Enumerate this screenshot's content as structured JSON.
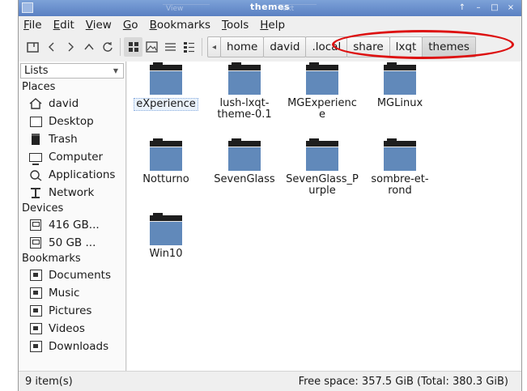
{
  "window": {
    "title": "themes",
    "ghost_tabs": [
      "View",
      "Text"
    ],
    "controls": [
      "↑",
      "–",
      "□",
      "×"
    ]
  },
  "menu": [
    "File",
    "Edit",
    "View",
    "Go",
    "Bookmarks",
    "Tools",
    "Help"
  ],
  "menu_mnemonics": [
    "F",
    "E",
    "V",
    "G",
    "B",
    "T",
    "H"
  ],
  "pathbar": {
    "scroll_left": "◂",
    "crumbs": [
      "home",
      "david",
      ".local",
      "share",
      "lxqt",
      "themes"
    ],
    "current": "themes"
  },
  "side_panel": {
    "mode": "Lists",
    "sections": {
      "places": {
        "title": "Places",
        "items": [
          {
            "label": "david",
            "icon": "home-icon"
          },
          {
            "label": "Desktop",
            "icon": "desktop-icon"
          },
          {
            "label": "Trash",
            "icon": "trash-icon"
          },
          {
            "label": "Computer",
            "icon": "computer-icon"
          },
          {
            "label": "Applications",
            "icon": "applications-icon"
          },
          {
            "label": "Network",
            "icon": "network-icon"
          }
        ]
      },
      "devices": {
        "title": "Devices",
        "items": [
          {
            "label": "416 GB...",
            "icon": "drive-icon"
          },
          {
            "label": "50 GB ...",
            "icon": "drive-icon"
          }
        ]
      },
      "bookmarks": {
        "title": "Bookmarks",
        "items": [
          {
            "label": "Documents",
            "icon": "documents-icon"
          },
          {
            "label": "Music",
            "icon": "music-icon"
          },
          {
            "label": "Pictures",
            "icon": "pictures-icon"
          },
          {
            "label": "Videos",
            "icon": "videos-icon"
          },
          {
            "label": "Downloads",
            "icon": "downloads-icon"
          }
        ]
      }
    }
  },
  "files": [
    {
      "name": "eXperience",
      "selected": true
    },
    {
      "name": "lush-lxqt-theme-0.1",
      "line1": "lush-lxqt-",
      "line2": "theme-0.1"
    },
    {
      "name": "MGExperience",
      "line1": "MGExperienc",
      "line2": "e"
    },
    {
      "name": "MGLinux"
    },
    {
      "name": "Notturno"
    },
    {
      "name": "SevenGlass"
    },
    {
      "name": "SevenGlass_Purple",
      "line1": "SevenGlass_P",
      "line2": "urple"
    },
    {
      "name": "sombre-et-rond",
      "line1": "sombre-et-",
      "line2": "rond"
    },
    {
      "name": "Win10"
    }
  ],
  "status": {
    "count": "9 item(s)",
    "space": "Free space: 357.5 GiB (Total: 380.3 GiB)"
  },
  "colors": {
    "folder": "#5d87b7",
    "titlebar": "#6a8fcd",
    "highlight_annotation": "#dd1111"
  }
}
